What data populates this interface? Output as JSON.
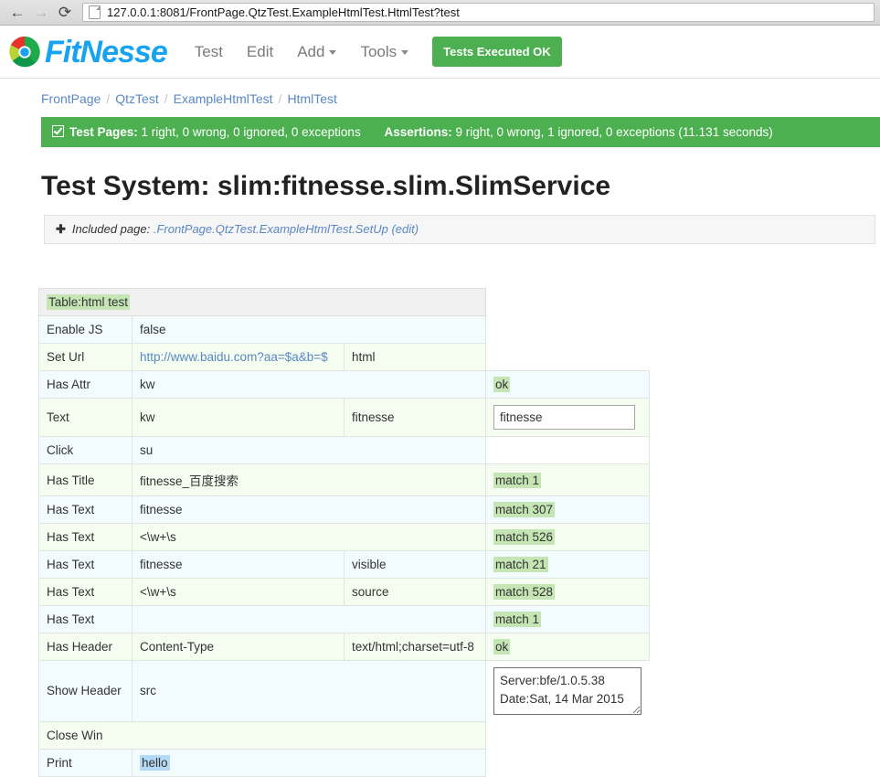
{
  "browser": {
    "back_icon": "back-arrow-icon",
    "forward_icon": "forward-arrow-icon",
    "reload_icon": "reload-icon",
    "url": "127.0.0.1:8081/FrontPage.QtzTest.ExampleHtmlTest.HtmlTest?test"
  },
  "header": {
    "logo_text": "FitNesse",
    "nav": [
      {
        "label": "Test",
        "has_caret": false
      },
      {
        "label": "Edit",
        "has_caret": false
      },
      {
        "label": "Add",
        "has_caret": true
      },
      {
        "label": "Tools",
        "has_caret": true
      }
    ],
    "status_button": "Tests Executed OK",
    "accent_green": "#4cb050",
    "logo_blue": "#17a3f0"
  },
  "breadcrumb": {
    "items": [
      "FrontPage",
      "QtzTest",
      "ExampleHtmlTest",
      "HtmlTest"
    ],
    "separator": "/"
  },
  "summary": {
    "test_pages_label": "Test Pages:",
    "test_pages_value": "1 right, 0 wrong, 0 ignored, 0 exceptions",
    "assertions_label": "Assertions:",
    "assertions_value": "9 right, 0 wrong, 1 ignored, 0 exceptions (11.131 seconds)"
  },
  "test_system": "Test System: slim:fitnesse.slim.SlimService",
  "included_page": {
    "plus": "✚",
    "label": "Included page:",
    "link": ".FrontPage.QtzTest.ExampleHtmlTest.SetUp",
    "edit": "(edit)"
  },
  "table": {
    "title": "Table:html test",
    "rows": [
      {
        "a": "Enable JS",
        "b": "false",
        "c": "",
        "d": ""
      },
      {
        "a": "Set Url",
        "b": "http://www.baidu.com?aa=$a&b=$",
        "c": "html",
        "d": ""
      },
      {
        "a": "Has Attr",
        "b": "kw",
        "c": "",
        "d": "ok"
      },
      {
        "a": "Text",
        "b": "kw",
        "c": "fitnesse",
        "d": "fitnesse"
      },
      {
        "a": "Click",
        "b": "su",
        "c": "",
        "d": ""
      },
      {
        "a": "Has Title",
        "b": "fitnesse_百度搜索",
        "c": "",
        "d": "match 1"
      },
      {
        "a": "Has Text",
        "b": "fitnesse",
        "c": "",
        "d": "match 307"
      },
      {
        "a": "Has Text",
        "b": "<\\w+\\s",
        "c": "",
        "d": "match 526"
      },
      {
        "a": "Has Text",
        "b": "fitnesse",
        "c": "visible",
        "d": "match 21"
      },
      {
        "a": "Has Text",
        "b": "<\\w+\\s",
        "c": "source",
        "d": "match 528"
      },
      {
        "a": "Has Text",
        "b": "",
        "c": "",
        "d": "match 1"
      },
      {
        "a": "Has Header",
        "b": "Content-Type",
        "c": "text/html;charset=utf-8",
        "d": "ok"
      },
      {
        "a": "Show Header",
        "b": "src",
        "c": "",
        "d": "Server:bfe/1.0.5.38\nDate:Sat, 14 Mar 2015"
      },
      {
        "a": "Close Win",
        "b": "",
        "c": "",
        "d": ""
      },
      {
        "a": "Print",
        "b": "hello",
        "c": "",
        "d": ""
      }
    ],
    "colors": {
      "row_blue": "#f2fbfd",
      "row_green": "#f4fdf0",
      "highlight_green": "#c5e5b5",
      "highlight_blue": "#b4d9f4",
      "link": "#5a87c5"
    }
  }
}
